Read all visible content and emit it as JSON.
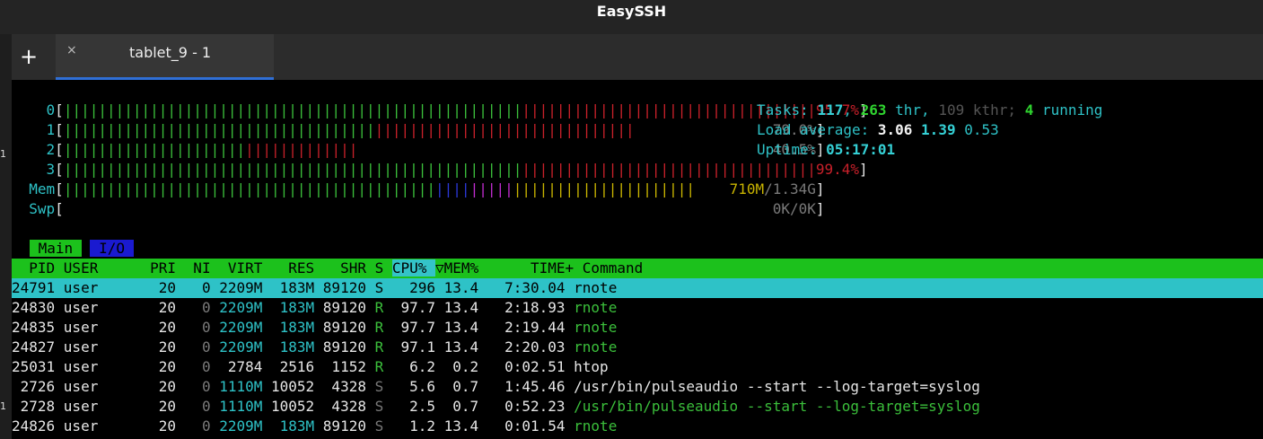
{
  "window": {
    "title": "EasySSH"
  },
  "tabs": {
    "new_tab_label": "+",
    "close_label": "×",
    "active_tab_label": "tablet_9 - 1"
  },
  "side_marks": [
    "1",
    "1"
  ],
  "meters": [
    {
      "label": "0",
      "green_bars": 53,
      "red_bars": 34,
      "percent": "95.7%",
      "percent_color": "red"
    },
    {
      "label": "1",
      "green_bars": 36,
      "red_bars": 30,
      "percent": "79.0%",
      "percent_color": "gray"
    },
    {
      "label": "2",
      "green_bars": 21,
      "red_bars": 13,
      "percent": "40.5%",
      "percent_color": "gray"
    },
    {
      "label": "3",
      "green_bars": 53,
      "red_bars": 34,
      "percent": "99.4%",
      "percent_color": "red"
    }
  ],
  "mem": {
    "label": "Mem",
    "green_bars": 43,
    "blue_bars": 4,
    "magenta_bars": 5,
    "yellow_bars": 21,
    "value": "710M",
    "total": "/1.34G"
  },
  "swp": {
    "label": "Swp",
    "value": "0K",
    "total": "/0K"
  },
  "stats": {
    "tasks_label": "Tasks:",
    "tasks": "117",
    "thr": "263",
    "thr_label": "thr,",
    "kthr": "109",
    "kthr_label": "kthr;",
    "running": "4",
    "running_label": "running",
    "load_label": "Load average:",
    "load1": "3.06",
    "load5": "1.39",
    "load15": "0.53",
    "uptime_label": "Uptime:",
    "uptime": "05:17:01"
  },
  "screen_tabs": {
    "main": "Main",
    "io": "I/O"
  },
  "columns": [
    "PID",
    "USER",
    "PRI",
    "NI",
    "VIRT",
    "RES",
    "SHR",
    "S",
    "CPU%",
    "▽MEM%",
    "TIME+",
    "Command"
  ],
  "processes": [
    {
      "pid": "24791",
      "user": "user",
      "pri": "20",
      "ni": "0",
      "virt": "2209M",
      "res": "183M",
      "shr": "89120",
      "s": "S",
      "cpu": "296",
      "mem": "13.4",
      "time": "7:30.04",
      "cmd": "rnote",
      "selected": true
    },
    {
      "pid": "24830",
      "user": "user",
      "pri": "20",
      "ni": "0",
      "virt": "2209M",
      "res": "183M",
      "shr": "89120",
      "s": "R",
      "cpu": "97.7",
      "mem": "13.4",
      "time": "2:18.93",
      "cmd": "rnote",
      "thread": true
    },
    {
      "pid": "24835",
      "user": "user",
      "pri": "20",
      "ni": "0",
      "virt": "2209M",
      "res": "183M",
      "shr": "89120",
      "s": "R",
      "cpu": "97.7",
      "mem": "13.4",
      "time": "2:19.44",
      "cmd": "rnote",
      "thread": true
    },
    {
      "pid": "24827",
      "user": "user",
      "pri": "20",
      "ni": "0",
      "virt": "2209M",
      "res": "183M",
      "shr": "89120",
      "s": "R",
      "cpu": "97.1",
      "mem": "13.4",
      "time": "2:20.03",
      "cmd": "rnote",
      "thread": true
    },
    {
      "pid": "25031",
      "user": "user",
      "pri": "20",
      "ni": "0",
      "virt": "2784",
      "res": "2516",
      "shr": "1152",
      "s": "R",
      "cpu": "6.2",
      "mem": "0.2",
      "time": "0:02.51",
      "cmd": "htop"
    },
    {
      "pid": "2726",
      "user": "user",
      "pri": "20",
      "ni": "0",
      "virt": "1110M",
      "res": "10052",
      "shr": "4328",
      "s": "S",
      "cpu": "5.6",
      "mem": "0.7",
      "time": "1:45.46",
      "cmd": "/usr/bin/pulseaudio --start --log-target=syslog"
    },
    {
      "pid": "2728",
      "user": "user",
      "pri": "20",
      "ni": "0",
      "virt": "1110M",
      "res": "10052",
      "shr": "4328",
      "s": "S",
      "cpu": "2.5",
      "mem": "0.7",
      "time": "0:52.23",
      "cmd": "/usr/bin/pulseaudio --start --log-target=syslog",
      "thread": true
    },
    {
      "pid": "24826",
      "user": "user",
      "pri": "20",
      "ni": "0",
      "virt": "2209M",
      "res": "183M",
      "shr": "89120",
      "s": "S",
      "cpu": "1.2",
      "mem": "13.4",
      "time": "0:01.54",
      "cmd": "rnote",
      "thread": true
    }
  ],
  "colors": {
    "header_bg": "#1cc11c",
    "selected_bg": "#2ec2c7",
    "tab_accent": "#2f6fd6"
  }
}
